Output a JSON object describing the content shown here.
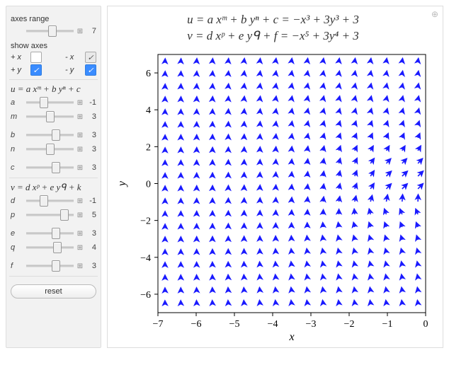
{
  "panel": {
    "axes_range": {
      "label": "axes range",
      "value": 7,
      "pos": 0.55
    },
    "show_axes_label": "show axes",
    "axes": {
      "px": {
        "label": "+ x",
        "checked": false,
        "style": "plain"
      },
      "mx": {
        "label": "- x",
        "checked": true,
        "style": "grey"
      },
      "py": {
        "label": "+ y",
        "checked": true,
        "style": "blue"
      },
      "my": {
        "label": "- y",
        "checked": true,
        "style": "blue"
      }
    },
    "eq_u": "u = a xᵐ + b yⁿ + c",
    "eq_v": "v = d xᵖ + e yᑫ + k",
    "sliders_u": [
      {
        "name": "a",
        "value": "-1",
        "pos": 0.38
      },
      {
        "name": "m",
        "value": "3",
        "pos": 0.5
      },
      {
        "name": "b",
        "value": "3",
        "pos": 0.62
      },
      {
        "name": "n",
        "value": "3",
        "pos": 0.5
      },
      {
        "name": "c",
        "value": "3",
        "pos": 0.62
      }
    ],
    "sliders_v": [
      {
        "name": "d",
        "value": "-1",
        "pos": 0.38
      },
      {
        "name": "p",
        "value": "5",
        "pos": 0.8
      },
      {
        "name": "e",
        "value": "3",
        "pos": 0.62
      },
      {
        "name": "q",
        "value": "4",
        "pos": 0.65
      },
      {
        "name": "f",
        "value": "3",
        "pos": 0.62
      }
    ],
    "reset": "reset"
  },
  "plot": {
    "title1": "u = a xᵐ + b yⁿ + c = −x³ + 3y³ + 3",
    "title2": "v = d xᵖ + e yᑫ + f = −x⁵ + 3y⁴ + 3",
    "xlabel": "x",
    "ylabel": "y",
    "x_ticks": [
      -7,
      -6,
      -5,
      -4,
      -3,
      -2,
      -1,
      0
    ],
    "y_ticks": [
      -6,
      -4,
      -2,
      0,
      2,
      4,
      6
    ]
  },
  "chart_data": {
    "type": "vector-field",
    "xrange": [
      -7,
      0
    ],
    "yrange": [
      -7,
      7
    ],
    "grid_step_x": 0.5,
    "grid_step_y": 1.0,
    "u_expr": "-x^3 + 3*y^3 + 3",
    "v_expr": "-x^5 + 3*y^4 + 3"
  }
}
